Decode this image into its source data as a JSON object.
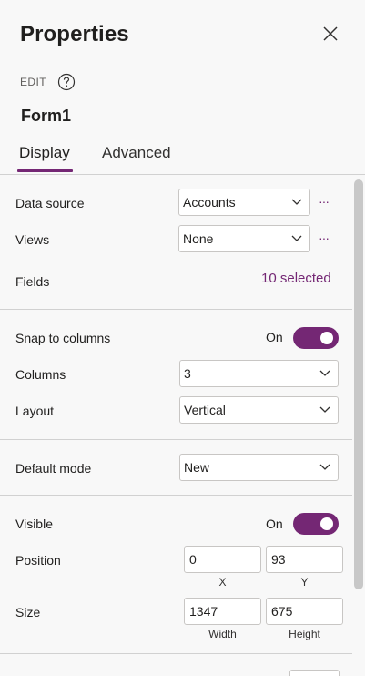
{
  "panel": {
    "title": "Properties",
    "edit_label": "EDIT",
    "control_name": "Form1"
  },
  "tabs": [
    {
      "label": "Display",
      "active": true
    },
    {
      "label": "Advanced",
      "active": false
    }
  ],
  "data_section": {
    "data_source": {
      "label": "Data source",
      "value": "Accounts",
      "more": "···"
    },
    "views": {
      "label": "Views",
      "value": "None",
      "more": "···"
    },
    "fields": {
      "label": "Fields",
      "value": "10 selected"
    }
  },
  "layout_section": {
    "snap": {
      "label": "Snap to columns",
      "state": "On"
    },
    "columns": {
      "label": "Columns",
      "value": "3"
    },
    "layout": {
      "label": "Layout",
      "value": "Vertical"
    }
  },
  "mode_section": {
    "default_mode": {
      "label": "Default mode",
      "value": "New"
    }
  },
  "display_section": {
    "visible": {
      "label": "Visible",
      "state": "On"
    },
    "position": {
      "label": "Position",
      "x": "0",
      "y": "93",
      "x_label": "X",
      "y_label": "Y"
    },
    "size": {
      "label": "Size",
      "width": "1347",
      "height": "675",
      "width_label": "Width",
      "height_label": "Height"
    }
  },
  "colors": {
    "accent": "#742774",
    "divider": "#d1d1d1",
    "panel_bg": "#f8f8f8"
  },
  "icons": [
    "close-icon",
    "help-icon",
    "chevron-down-icon",
    "more-icon"
  ]
}
